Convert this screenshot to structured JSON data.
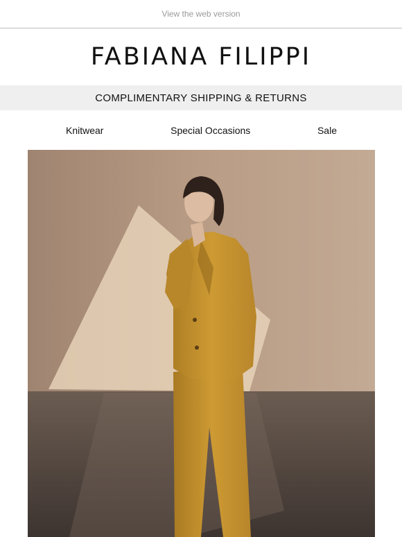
{
  "header": {
    "web_version_link": "View the web version",
    "brand": "FABIANA FILIPPI"
  },
  "banner": {
    "text": "COMPLIMENTARY SHIPPING & RETURNS"
  },
  "nav": {
    "items": [
      {
        "label": "Knitwear"
      },
      {
        "label": "Special Occasions"
      },
      {
        "label": "Sale"
      }
    ]
  },
  "hero": {
    "suit_color": "#c8962e",
    "wall_color": "#b79a82",
    "floor_color": "#5a4d44"
  }
}
